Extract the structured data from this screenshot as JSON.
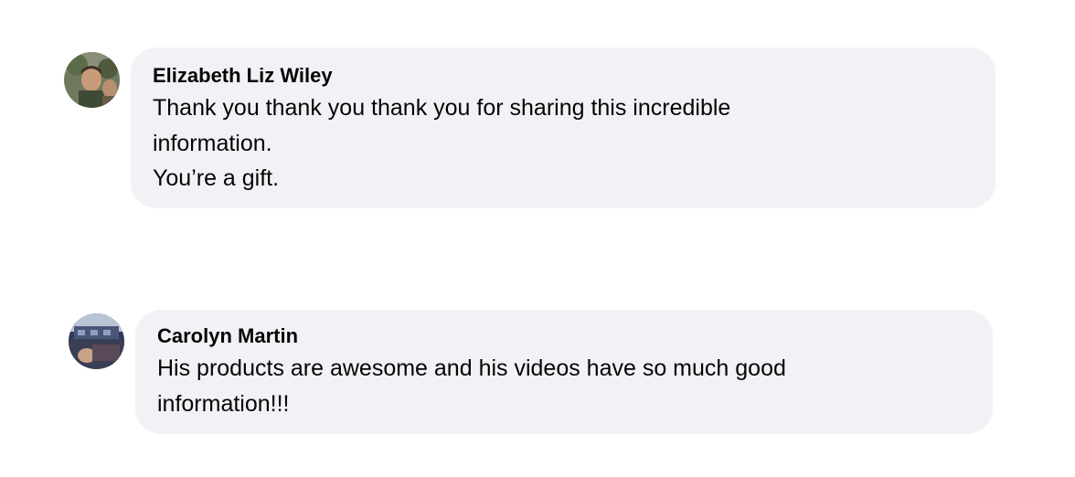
{
  "comments": [
    {
      "author": "Elizabeth Liz Wiley",
      "lines": [
        "Thank you thank you thank you for sharing this incredible",
        "information.",
        "You’re a gift."
      ],
      "avatar_icon": "profile-photo-icon"
    },
    {
      "author": "Carolyn Martin",
      "lines": [
        "His products are awesome and his videos have so much good",
        "information!!!"
      ],
      "avatar_icon": "profile-photo-icon"
    }
  ],
  "colors": {
    "bubble": "#f0f2f5",
    "text": "#050505"
  }
}
